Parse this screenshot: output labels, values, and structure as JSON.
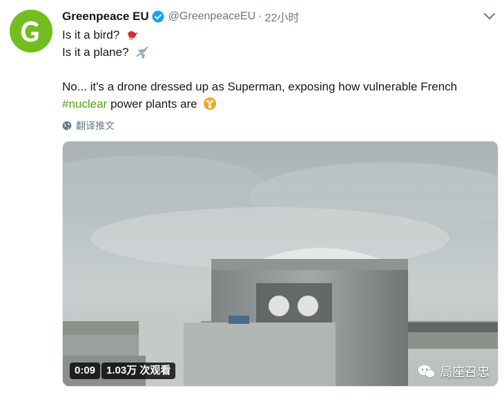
{
  "tweet": {
    "author_name": "Greenpeace EU",
    "handle": "@GreenpeaceEU",
    "separator": "·",
    "time": "22小时",
    "lines": {
      "l1": "Is it a bird?",
      "l2": "Is it a plane?",
      "l3": "No... it's a drone dressed up as Superman, exposing how vulnerable French",
      "hashtag": "#nuclear",
      "l4_rest": " power plants are"
    },
    "emoji": {
      "bird": "bird-emoji",
      "plane": "airplane-emoji",
      "radioactive": "radioactive-emoji"
    },
    "translate_label": "翻译推文"
  },
  "video": {
    "duration": "0:09",
    "views": "1.03万 次观看",
    "watermark": "局座召忠"
  },
  "colors": {
    "brand_green": "#73be1e",
    "hashtag": "#4ca70a",
    "verified": "#1da1f2"
  }
}
